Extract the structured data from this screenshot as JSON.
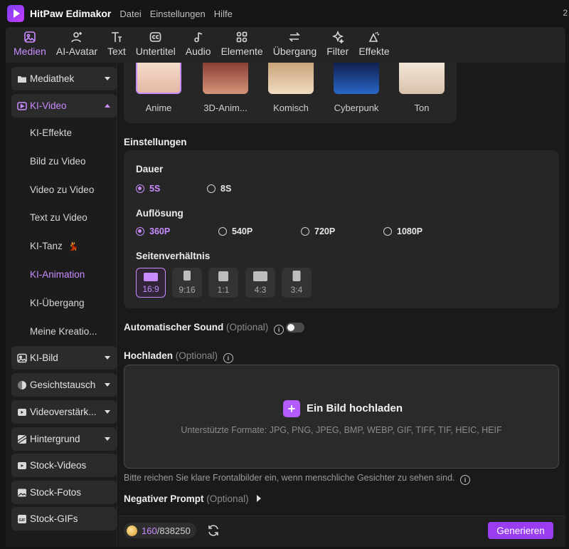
{
  "app": {
    "title": "HitPaw Edimakor",
    "menu": [
      "Datei",
      "Einstellungen",
      "Hilfe"
    ],
    "right_fragment": "2"
  },
  "toolbar": {
    "items": [
      {
        "label": "Medien",
        "icon": "media-icon",
        "active": true
      },
      {
        "label": "AI-Avatar",
        "icon": "avatar-icon"
      },
      {
        "label": "Text",
        "icon": "text-icon"
      },
      {
        "label": "Untertitel",
        "icon": "subtitle-icon"
      },
      {
        "label": "Audio",
        "icon": "audio-icon"
      },
      {
        "label": "Elemente",
        "icon": "elements-icon"
      },
      {
        "label": "Übergang",
        "icon": "transition-icon"
      },
      {
        "label": "Filter",
        "icon": "filter-icon"
      },
      {
        "label": "Effekte",
        "icon": "effects-icon"
      }
    ]
  },
  "sidebar": {
    "mediathek": "Mediathek",
    "ki_video": "KI-Video",
    "ki_video_items": [
      "KI-Effekte",
      "Bild zu Video",
      "Video zu Video",
      "Text zu Video",
      "KI-Tanz",
      "KI-Animation",
      "KI-Übergang",
      "Meine Kreatio..."
    ],
    "ki_tanz_emoji": "💃",
    "ki_bild": "KI-Bild",
    "gesichtstausch": "Gesichtstausch",
    "videoverstaerker": "Videoverstärk...",
    "hintergrund": "Hintergrund",
    "stock_videos": "Stock-Videos",
    "stock_fotos": "Stock-Fotos",
    "stock_gifs": "Stock-GIFs",
    "gif_badge": "GIF"
  },
  "styles": {
    "items": [
      {
        "label": "Anime",
        "selected": true,
        "bg": "#e9c9b7"
      },
      {
        "label": "3D-Anim...",
        "bg": "#b86a57"
      },
      {
        "label": "Komisch",
        "bg": "#d7b48a"
      },
      {
        "label": "Cyberpunk",
        "bg": "#1b3b7a"
      },
      {
        "label": "Ton",
        "bg": "#e8d9c9"
      }
    ]
  },
  "settings": {
    "title": "Einstellungen",
    "duration": {
      "label": "Dauer",
      "options": [
        "5S",
        "8S"
      ],
      "selected": "5S"
    },
    "resolution": {
      "label": "Auflösung",
      "options": [
        "360P",
        "540P",
        "720P",
        "1080P"
      ],
      "selected": "360P"
    },
    "aspect": {
      "label": "Seitenverhältnis",
      "options": [
        "16:9",
        "9:16",
        "1:1",
        "4:3",
        "3:4"
      ],
      "selected": "16:9"
    }
  },
  "sound": {
    "label": "Automatischer Sound",
    "optional": "(Optional)",
    "info": "i",
    "enabled": false
  },
  "upload": {
    "label": "Hochladen",
    "optional": "(Optional)",
    "info": "i",
    "button": "Ein Bild hochladen",
    "plus": "+",
    "formats": "Unterstützte Formate: JPG, PNG, JPEG, BMP, WEBP, GIF, TIFF, TIF, HEIC, HEIF",
    "hint": "Bitte reichen Sie klare Frontalbilder ein, wenn menschliche Gesichter zu sehen sind.",
    "hint_info": "i"
  },
  "negative_prompt": {
    "label": "Negativer Prompt",
    "optional": "(Optional)"
  },
  "footer": {
    "credits_used": "160",
    "credits_total": "/838250",
    "generate": "Generieren"
  },
  "colors": {
    "accent": "#c98cff",
    "button": "#9a3cf0"
  }
}
